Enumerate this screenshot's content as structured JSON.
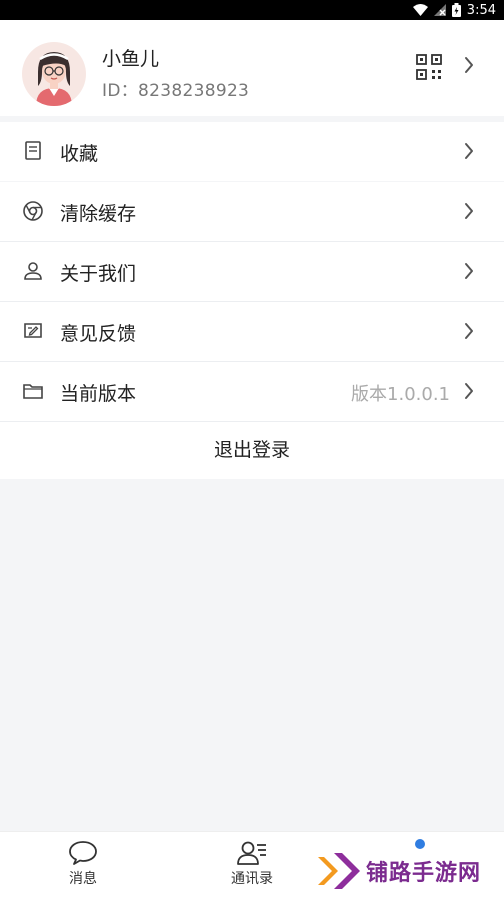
{
  "status_bar": {
    "time": "3:54"
  },
  "profile": {
    "name": "小鱼儿",
    "id_label": "ID：",
    "id_value": "8238238923"
  },
  "menu": [
    {
      "label": "收藏",
      "icon": "bookmark-icon"
    },
    {
      "label": "清除缓存",
      "icon": "chrome-icon"
    },
    {
      "label": "关于我们",
      "icon": "person-icon"
    },
    {
      "label": "意见反馈",
      "icon": "feedback-icon"
    },
    {
      "label": "当前版本",
      "icon": "folder-icon",
      "value": "版本1.0.0.1"
    }
  ],
  "logout_label": "退出登录",
  "tabs": [
    {
      "label": "消息",
      "icon": "chat-bubble-icon"
    },
    {
      "label": "通讯录",
      "icon": "contacts-icon"
    }
  ],
  "watermark": {
    "text": "铺路手游网"
  },
  "colors": {
    "accent": "#2f7de1",
    "background": "#f4f5f7",
    "watermark": "#7b2b8f"
  }
}
